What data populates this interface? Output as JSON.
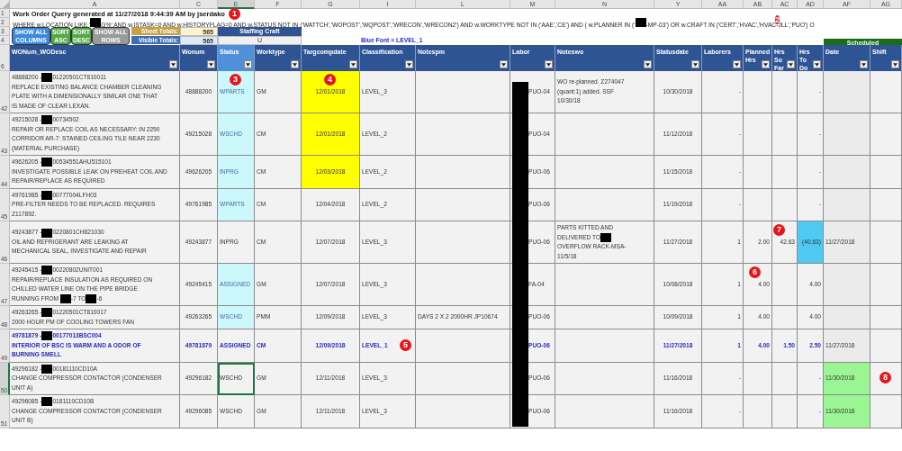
{
  "title": {
    "row_number": "1",
    "text": "Work Order Query generated at 11/27/2018 9:44:39 AM by jserdako",
    "callout": "1"
  },
  "query": {
    "row_number": "2",
    "segments": [
      "WHERE w.LOCATION LIKE '",
      {
        "kind": "redacted"
      },
      "G%' AND w.ISTASK=0 AND w.HISTORYFLAG=0 AND w.STATUS NOT IN ('WATTCH','WOPOST','WQPOST','WRECON','WRECON2') AND w.WORKTYPE NOT IN ('AAE','CE') AND ( w.PLANNER IN ('",
      {
        "kind": "redacted"
      },
      "-MP-03') OR w.CRAFT IN ('CERT','HVAC','HVAC-JLL','PUO') O"
    ],
    "callout": "2"
  },
  "controls": {
    "row_numbers": [
      "3",
      "4"
    ],
    "buttons": [
      {
        "label": "SHOW ALL COLUMNS",
        "kind": "blue"
      },
      {
        "label": "SORT ASC",
        "kind": "green"
      },
      {
        "label": "SORT DESC",
        "kind": "green"
      },
      {
        "label": "SHOW ALL ROWS",
        "kind": "gray"
      }
    ],
    "totals": [
      {
        "label": "Sheet Totals:",
        "value": "565",
        "kind": "sheet"
      },
      {
        "label": "Visible Totals:",
        "value": "565",
        "kind": "visible"
      }
    ],
    "staffing_craft": {
      "label": "Staffing Craft",
      "value": "U"
    },
    "legend": "Blue Font = LEVEL_1",
    "scheduled_group": "Scheduled"
  },
  "table": {
    "header_row_number": "6",
    "columns": [
      {
        "letter": "A",
        "header": "WONum_WODesc",
        "selected": false,
        "kind": "text"
      },
      {
        "letter": "C",
        "header": "Wonum",
        "selected": false,
        "kind": "center"
      },
      {
        "letter": "E",
        "header": "Status",
        "selected": true,
        "kind": "text"
      },
      {
        "letter": "F",
        "header": "Worktype",
        "selected": false,
        "kind": "text"
      },
      {
        "letter": "G",
        "header": "Targcompdate",
        "selected": false,
        "kind": "center"
      },
      {
        "letter": "I",
        "header": "Classification",
        "selected": false,
        "kind": "text"
      },
      {
        "letter": "L",
        "header": "Notespm",
        "selected": false,
        "kind": "text"
      },
      {
        "letter": "M",
        "header": "Labor",
        "selected": false,
        "kind": "labor",
        "redacted": true
      },
      {
        "letter": "N",
        "header": "Noteswo",
        "selected": false,
        "kind": "text"
      },
      {
        "letter": "Y",
        "header": "Statusdate",
        "selected": false,
        "kind": "center"
      },
      {
        "letter": "AA",
        "header": "Laborers",
        "selected": false,
        "kind": "number"
      },
      {
        "letter": "AB",
        "header": "Planned Hrs",
        "selected": false,
        "kind": "number"
      },
      {
        "letter": "AC",
        "header": "Hrs So Far",
        "selected": false,
        "kind": "number"
      },
      {
        "letter": "AD",
        "header": "Hrs To Do",
        "selected": false,
        "kind": "number"
      },
      {
        "letter": "AF",
        "header": "Date",
        "selected": false,
        "kind": "text"
      },
      {
        "letter": "AG",
        "header": "Shift",
        "selected": false,
        "kind": "text"
      }
    ],
    "rows": [
      {
        "row_number": "42",
        "selected": false,
        "highlighted": false,
        "cells": [
          {
            "lines": [
              [
                "48888200 -",
                {
                  "kind": "redacted"
                },
                "01220501CT810011"
              ],
              [
                "REPLACE EXISTING BALANCE CHAMBER CLEANING"
              ],
              [
                "PLATE WITH A DIMENSIONALLY SIMILAR ONE THAT"
              ],
              [
                "IS MADE OF CLEAR LEXAN."
              ]
            ]
          },
          {
            "text": "48888200"
          },
          {
            "text": "WPARTS",
            "color": "#ccf7fb",
            "callout": "3"
          },
          {
            "text": "GM"
          },
          {
            "text": "12/01/2018",
            "color": "#ffff00",
            "callout": "4"
          },
          {
            "text": "LEVEL_3"
          },
          {},
          {
            "text": "PUO-04"
          },
          {
            "lines": [
              [
                "WO re-planned. Z274047"
              ],
              [
                "(quant:1) added. SSF"
              ],
              [
                "10/30/18"
              ]
            ]
          },
          {
            "text": "10/30/2018"
          },
          {
            "text": "-"
          },
          {},
          {},
          {
            "text": "-"
          },
          {},
          {}
        ]
      },
      {
        "row_number": "43",
        "selected": false,
        "highlighted": false,
        "cells": [
          {
            "lines": [
              [
                "49215028 -",
                {
                  "kind": "redacted"
                },
                "00734502"
              ],
              [
                "REPAIR OR REPLACE COIL AS NECESSARY: IN 2290"
              ],
              [
                "CORRIDOR AR-7: STAINED CEILING TILE NEAR 2230"
              ],
              [
                "(MATERIAL PURCHASE)"
              ]
            ]
          },
          {
            "text": "49215028"
          },
          {
            "text": "WSCHD",
            "color": "#ccf7fb"
          },
          {
            "text": "CM"
          },
          {
            "text": "12/01/2018",
            "color": "#ffff00"
          },
          {
            "text": "LEVEL_2"
          },
          {},
          {
            "text": "PUO-04"
          },
          {},
          {
            "text": "11/12/2018"
          },
          {
            "text": "-"
          },
          {},
          {},
          {
            "text": "-"
          },
          {},
          {}
        ]
      },
      {
        "row_number": "44",
        "selected": false,
        "highlighted": false,
        "cells": [
          {
            "lines": [
              [
                "49626205 -",
                {
                  "kind": "redacted"
                },
                "00534551AHU515101"
              ],
              [
                "INVESTIGATE POSSIBLE LEAK ON PREHEAT COIL AND"
              ],
              [
                "REPAIR/REPLACE AS REQUIRED"
              ]
            ]
          },
          {
            "text": "49626205"
          },
          {
            "text": "INPRG",
            "color": "#ccf7fb"
          },
          {
            "text": "CM"
          },
          {
            "text": "12/03/2018",
            "color": "#ffff00"
          },
          {
            "text": "LEVEL_2"
          },
          {},
          {
            "text": "PUO-06"
          },
          {},
          {
            "text": "11/15/2018"
          },
          {
            "text": "-"
          },
          {},
          {},
          {
            "text": "-"
          },
          {},
          {}
        ]
      },
      {
        "row_number": "45",
        "selected": false,
        "highlighted": false,
        "cells": [
          {
            "lines": [
              [
                "49761985 -",
                {
                  "kind": "redacted"
                },
                "00777004LFH03"
              ],
              [
                "PRE-FILTER NEEDS TO BE REPLACED. REQUIRES"
              ],
              [
                "Z117892."
              ]
            ]
          },
          {
            "text": "49761985"
          },
          {
            "text": "WPARTS",
            "color": "#ccf7fb"
          },
          {
            "text": "CM"
          },
          {
            "text": "12/04/2018"
          },
          {
            "text": "LEVEL_2"
          },
          {},
          {
            "text": "PUO-06"
          },
          {},
          {
            "text": "11/19/2018"
          },
          {
            "text": "-"
          },
          {},
          {},
          {
            "text": "-"
          },
          {},
          {}
        ]
      },
      {
        "row_number": "46",
        "selected": false,
        "highlighted": false,
        "cells": [
          {
            "lines": [
              [
                "49243877 -",
                {
                  "kind": "redacted"
                },
                "0220801CH821030"
              ],
              [
                "OIL AND REFRIGERANT ARE LEAKING AT"
              ],
              [
                "MECHANICAL SEAL, INVESTIGATE AND REPAIR"
              ]
            ]
          },
          {
            "text": "49243877"
          },
          {
            "text": "INPRG"
          },
          {
            "text": "CM"
          },
          {
            "text": "12/07/2018"
          },
          {
            "text": "LEVEL_3"
          },
          {},
          {
            "text": "PUO-06"
          },
          {
            "lines": [
              [
                "PARTS KITTED AND"
              ],
              [
                "DELIVERED TO",
                {
                  "kind": "redacted"
                }
              ],
              [
                "OVERFLOW RACK-MSA-"
              ],
              [
                "11/5/18"
              ]
            ]
          },
          {
            "text": "11/27/2018"
          },
          {
            "text": "1"
          },
          {
            "text": "2.00"
          },
          {
            "text": "42.63",
            "callout": "7"
          },
          {
            "text": "(40.63)",
            "color": "#4fcaf2"
          },
          {
            "text": "11/27/2018"
          },
          {}
        ]
      },
      {
        "row_number": "47",
        "selected": false,
        "highlighted": false,
        "cells": [
          {
            "lines": [
              [
                "49245415 -",
                {
                  "kind": "redacted"
                },
                "00220802UNIT001"
              ],
              [
                "REPAIR/REPLACE INSULATION AS REQUIRED ON"
              ],
              [
                "CHILLED WATER LINE ON THE PIPE BRIDGE"
              ],
              [
                "RUNNING FROM ",
                {
                  "kind": "redacted"
                },
                "-7 TO",
                {
                  "kind": "redacted"
                },
                "-6"
              ]
            ]
          },
          {
            "text": "49245415"
          },
          {
            "text": "ASSIGNED",
            "color": "#ccf7fb"
          },
          {
            "text": "GM"
          },
          {
            "text": "12/07/2018"
          },
          {
            "text": "LEVEL_3"
          },
          {},
          {
            "text": "FA-04"
          },
          {},
          {
            "text": "10/08/2018"
          },
          {
            "text": "1"
          },
          {
            "text": "4.00",
            "callout": "6"
          },
          {},
          {
            "text": "4.00"
          },
          {},
          {}
        ]
      },
      {
        "row_number": "48",
        "selected": false,
        "highlighted": false,
        "cells": [
          {
            "lines": [
              [
                "49263265 -",
                {
                  "kind": "redacted"
                },
                "01220501CT810017"
              ],
              [
                "2000 HOUR PM OF COOLING TOWERS FAN"
              ]
            ]
          },
          {
            "text": "49263265"
          },
          {
            "text": "WSCHD",
            "color": "#ccf7fb"
          },
          {
            "text": "PMM"
          },
          {
            "text": "12/09/2018"
          },
          {
            "text": "LEVEL_3"
          },
          {
            "text": "DAYS 2 X 2 2000HR JP10674"
          },
          {
            "text": "PUO-06"
          },
          {},
          {
            "text": "10/09/2018"
          },
          {
            "text": "1"
          },
          {
            "text": "4.00"
          },
          {},
          {
            "text": "4.00"
          },
          {},
          {}
        ]
      },
      {
        "row_number": "49",
        "selected": false,
        "highlighted": true,
        "cells": [
          {
            "lines": [
              [
                "49781879 -",
                {
                  "kind": "redacted"
                },
                "00177013BSC004"
              ],
              [
                "INTERIOR OF BSC IS WARM AND A ODOR OF"
              ],
              [
                "BURNING SMELL"
              ]
            ]
          },
          {
            "text": "49781879"
          },
          {
            "text": "ASSIGNED"
          },
          {
            "text": "CM"
          },
          {
            "text": "12/09/2018"
          },
          {
            "text": "LEVEL_1",
            "callout": "5"
          },
          {},
          {
            "text": "PUO-06"
          },
          {},
          {
            "text": "11/27/2018"
          },
          {
            "text": "1"
          },
          {
            "text": "4.00"
          },
          {
            "text": "1.50"
          },
          {
            "text": "2.50"
          },
          {
            "text": "11/27/2018"
          },
          {}
        ]
      },
      {
        "row_number": "50",
        "selected": true,
        "highlighted": false,
        "cells": [
          {
            "lines": [
              [
                "49296182 -",
                {
                  "kind": "redacted"
                },
                "00181110CD10A"
              ],
              [
                "CHANGE COMPRESSOR CONTACTOR (CONDENSER"
              ],
              [
                "UNIT A)"
              ]
            ]
          },
          {
            "text": "49296182"
          },
          {
            "text": "WSCHD"
          },
          {
            "text": "GM"
          },
          {
            "text": "12/11/2018"
          },
          {
            "text": "LEVEL_3"
          },
          {},
          {
            "text": "PUO-06"
          },
          {},
          {
            "text": "11/16/2018"
          },
          {
            "text": "-"
          },
          {},
          {},
          {
            "text": "-"
          },
          {
            "text": "11/30/2018",
            "color": "#9cf595"
          },
          {
            "callout": "8"
          }
        ]
      },
      {
        "row_number": "51",
        "selected": false,
        "highlighted": false,
        "cells": [
          {
            "lines": [
              [
                "49296085 -",
                {
                  "kind": "redacted"
                },
                "0181110CD10B"
              ],
              [
                "CHANGE COMPRESSOR CONTACTOR (CONDENSER"
              ],
              [
                "UNIT B)"
              ]
            ]
          },
          {
            "text": "49296085"
          },
          {
            "text": "WSCHD"
          },
          {
            "text": "GM"
          },
          {
            "text": "12/11/2018"
          },
          {
            "text": "LEVEL_3"
          },
          {},
          {
            "text": "PUO-06"
          },
          {},
          {
            "text": "11/16/2018"
          },
          {
            "text": "-"
          },
          {},
          {},
          {
            "text": "-"
          },
          {
            "text": "11/30/2018",
            "color": "#9cf595"
          },
          {}
        ]
      }
    ]
  }
}
